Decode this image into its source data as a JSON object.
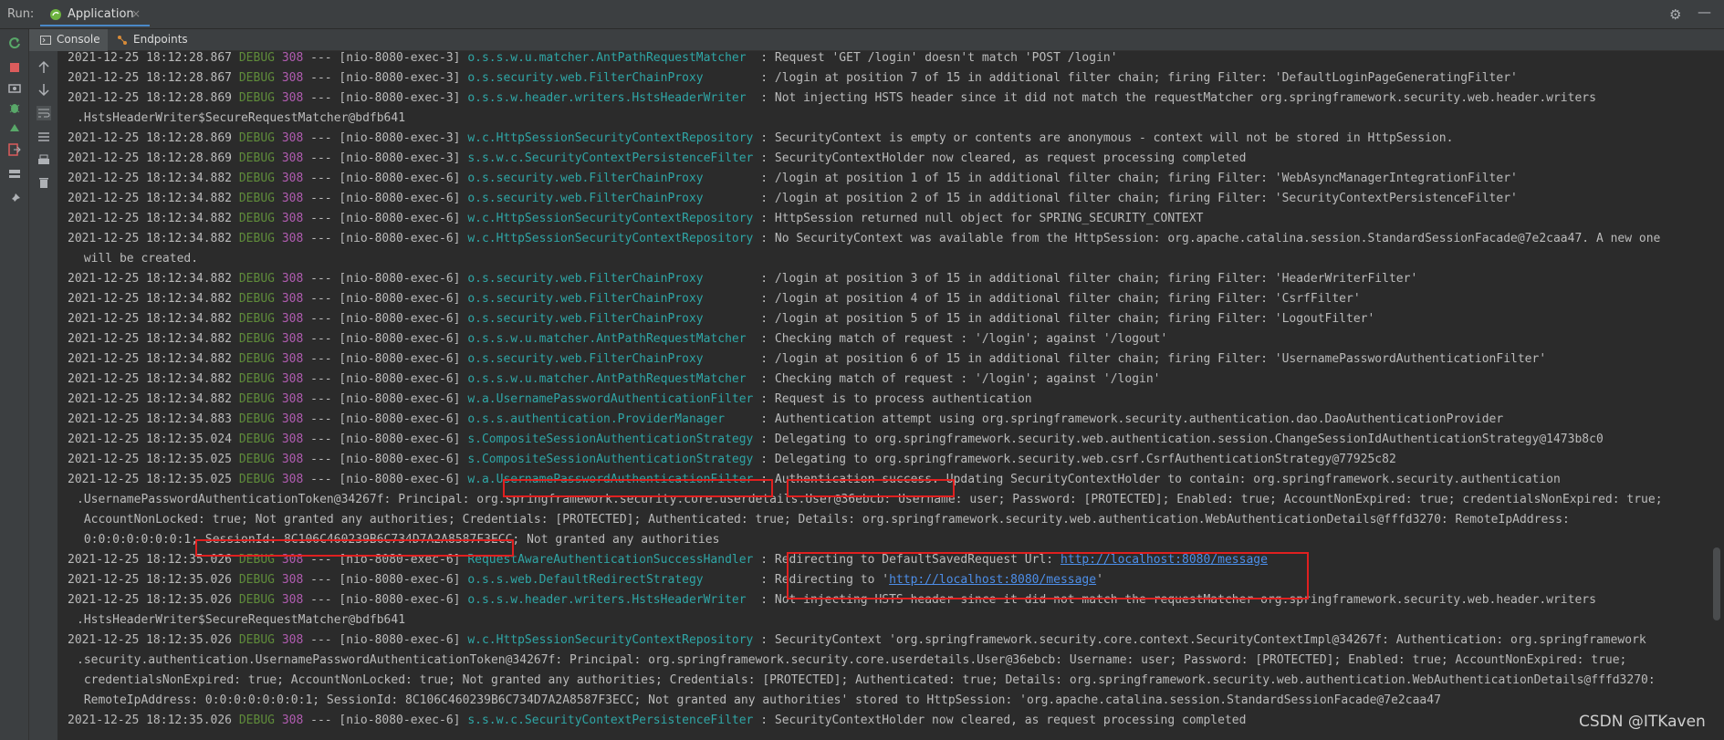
{
  "runbar": {
    "run_label": "Run:",
    "tab_title": "Application",
    "tab_close": "×"
  },
  "subtabs": {
    "console": "Console",
    "endpoints": "Endpoints"
  },
  "colors": {
    "debug": "#5f8c3a",
    "pid": "#b05cb0",
    "logger": "#2fa6a6",
    "highlight": "#e02020"
  },
  "log": [
    {
      "ts": "2021-12-25 18:12:28.867",
      "lvl": "DEBUG",
      "pid": "308",
      "thread": " --- [nio-8080-exec-3] ",
      "logger": "o.s.s.w.u.matcher.AntPathRequestMatcher  ",
      "msg": ": Request 'GET /login' doesn't match 'POST /login'"
    },
    {
      "ts": "2021-12-25 18:12:28.867",
      "lvl": "DEBUG",
      "pid": "308",
      "thread": " --- [nio-8080-exec-3] ",
      "logger": "o.s.security.web.FilterChainProxy        ",
      "msg": ": /login at position 7 of 15 in additional filter chain; firing Filter: 'DefaultLoginPageGeneratingFilter'"
    },
    {
      "ts": "2021-12-25 18:12:28.869",
      "lvl": "DEBUG",
      "pid": "308",
      "thread": " --- [nio-8080-exec-3] ",
      "logger": "o.s.s.w.header.writers.HstsHeaderWriter  ",
      "msg": ": Not injecting HSTS header since it did not match the requestMatcher org.springframework.security.web.header.writers"
    },
    {
      "cont": ".HstsHeaderWriter$SecureRequestMatcher@bdfb641"
    },
    {
      "ts": "2021-12-25 18:12:28.869",
      "lvl": "DEBUG",
      "pid": "308",
      "thread": " --- [nio-8080-exec-3] ",
      "logger": "w.c.HttpSessionSecurityContextRepository ",
      "msg": ": SecurityContext is empty or contents are anonymous - context will not be stored in HttpSession."
    },
    {
      "ts": "2021-12-25 18:12:28.869",
      "lvl": "DEBUG",
      "pid": "308",
      "thread": " --- [nio-8080-exec-3] ",
      "logger": "s.s.w.c.SecurityContextPersistenceFilter ",
      "msg": ": SecurityContextHolder now cleared, as request processing completed"
    },
    {
      "ts": "2021-12-25 18:12:34.882",
      "lvl": "DEBUG",
      "pid": "308",
      "thread": " --- [nio-8080-exec-6] ",
      "logger": "o.s.security.web.FilterChainProxy        ",
      "msg": ": /login at position 1 of 15 in additional filter chain; firing Filter: 'WebAsyncManagerIntegrationFilter'"
    },
    {
      "ts": "2021-12-25 18:12:34.882",
      "lvl": "DEBUG",
      "pid": "308",
      "thread": " --- [nio-8080-exec-6] ",
      "logger": "o.s.security.web.FilterChainProxy        ",
      "msg": ": /login at position 2 of 15 in additional filter chain; firing Filter: 'SecurityContextPersistenceFilter'"
    },
    {
      "ts": "2021-12-25 18:12:34.882",
      "lvl": "DEBUG",
      "pid": "308",
      "thread": " --- [nio-8080-exec-6] ",
      "logger": "w.c.HttpSessionSecurityContextRepository ",
      "msg": ": HttpSession returned null object for SPRING_SECURITY_CONTEXT"
    },
    {
      "ts": "2021-12-25 18:12:34.882",
      "lvl": "DEBUG",
      "pid": "308",
      "thread": " --- [nio-8080-exec-6] ",
      "logger": "w.c.HttpSessionSecurityContextRepository ",
      "msg": ": No SecurityContext was available from the HttpSession: org.apache.catalina.session.StandardSessionFacade@7e2caa47. A new one"
    },
    {
      "cont": " will be created."
    },
    {
      "ts": "2021-12-25 18:12:34.882",
      "lvl": "DEBUG",
      "pid": "308",
      "thread": " --- [nio-8080-exec-6] ",
      "logger": "o.s.security.web.FilterChainProxy        ",
      "msg": ": /login at position 3 of 15 in additional filter chain; firing Filter: 'HeaderWriterFilter'"
    },
    {
      "ts": "2021-12-25 18:12:34.882",
      "lvl": "DEBUG",
      "pid": "308",
      "thread": " --- [nio-8080-exec-6] ",
      "logger": "o.s.security.web.FilterChainProxy        ",
      "msg": ": /login at position 4 of 15 in additional filter chain; firing Filter: 'CsrfFilter'"
    },
    {
      "ts": "2021-12-25 18:12:34.882",
      "lvl": "DEBUG",
      "pid": "308",
      "thread": " --- [nio-8080-exec-6] ",
      "logger": "o.s.security.web.FilterChainProxy        ",
      "msg": ": /login at position 5 of 15 in additional filter chain; firing Filter: 'LogoutFilter'"
    },
    {
      "ts": "2021-12-25 18:12:34.882",
      "lvl": "DEBUG",
      "pid": "308",
      "thread": " --- [nio-8080-exec-6] ",
      "logger": "o.s.s.w.u.matcher.AntPathRequestMatcher  ",
      "msg": ": Checking match of request : '/login'; against '/logout'"
    },
    {
      "ts": "2021-12-25 18:12:34.882",
      "lvl": "DEBUG",
      "pid": "308",
      "thread": " --- [nio-8080-exec-6] ",
      "logger": "o.s.security.web.FilterChainProxy        ",
      "msg": ": /login at position 6 of 15 in additional filter chain; firing Filter: 'UsernamePasswordAuthenticationFilter'"
    },
    {
      "ts": "2021-12-25 18:12:34.882",
      "lvl": "DEBUG",
      "pid": "308",
      "thread": " --- [nio-8080-exec-6] ",
      "logger": "o.s.s.w.u.matcher.AntPathRequestMatcher  ",
      "msg": ": Checking match of request : '/login'; against '/login'"
    },
    {
      "ts": "2021-12-25 18:12:34.882",
      "lvl": "DEBUG",
      "pid": "308",
      "thread": " --- [nio-8080-exec-6] ",
      "logger": "w.a.UsernamePasswordAuthenticationFilter ",
      "msg": ": Request is to process authentication"
    },
    {
      "ts": "2021-12-25 18:12:34.883",
      "lvl": "DEBUG",
      "pid": "308",
      "thread": " --- [nio-8080-exec-6] ",
      "logger": "o.s.s.authentication.ProviderManager     ",
      "msg": ": Authentication attempt using org.springframework.security.authentication.dao.DaoAuthenticationProvider"
    },
    {
      "ts": "2021-12-25 18:12:35.024",
      "lvl": "DEBUG",
      "pid": "308",
      "thread": " --- [nio-8080-exec-6] ",
      "logger": "s.CompositeSessionAuthenticationStrategy ",
      "msg": ": Delegating to org.springframework.security.web.authentication.session.ChangeSessionIdAuthenticationStrategy@1473b8c0"
    },
    {
      "ts": "2021-12-25 18:12:35.025",
      "lvl": "DEBUG",
      "pid": "308",
      "thread": " --- [nio-8080-exec-6] ",
      "logger": "s.CompositeSessionAuthenticationStrategy ",
      "msg": ": Delegating to org.springframework.security.web.csrf.CsrfAuthenticationStrategy@77925c82"
    },
    {
      "ts": "2021-12-25 18:12:35.025",
      "lvl": "DEBUG",
      "pid": "308",
      "thread": " --- [nio-8080-exec-6] ",
      "logger": "w.a.UsernamePasswordAuthenticationFilter ",
      "msg": ": Authentication success. Updating SecurityContextHolder to contain: org.springframework.security.authentication"
    },
    {
      "cont": ".UsernamePasswordAuthenticationToken@34267f: Principal: org.springframework.security.core.userdetails.User@36ebcb: Username: user; Password: [PROTECTED]; Enabled: true; AccountNonExpired: true; credentialsNonExpired: true;"
    },
    {
      "cont": " AccountNonLocked: true; Not granted any authorities; Credentials: [PROTECTED]; Authenticated: true; Details: org.springframework.security.web.authentication.WebAuthenticationDetails@fffd3270: RemoteIpAddress:"
    },
    {
      "cont": " 0:0:0:0:0:0:0:1; SessionId: 8C106C460239B6C734D7A2A8587F3ECC; Not granted any authorities"
    },
    {
      "ts": "2021-12-25 18:12:35.026",
      "lvl": "DEBUG",
      "pid": "308",
      "thread": " --- [nio-8080-exec-6] ",
      "logger": "RequestAwareAuthenticationSuccessHandler ",
      "msg": ": Redirecting to DefaultSavedRequest Url: ",
      "link": "http://localhost:8080/message",
      "tail": ""
    },
    {
      "ts": "2021-12-25 18:12:35.026",
      "lvl": "DEBUG",
      "pid": "308",
      "thread": " --- [nio-8080-exec-6] ",
      "logger": "o.s.s.web.DefaultRedirectStrategy        ",
      "msg": ": Redirecting to '",
      "link": "http://localhost:8080/message",
      "tail": "'"
    },
    {
      "ts": "2021-12-25 18:12:35.026",
      "lvl": "DEBUG",
      "pid": "308",
      "thread": " --- [nio-8080-exec-6] ",
      "logger": "o.s.s.w.header.writers.HstsHeaderWriter  ",
      "msg": ": Not injecting HSTS header since it did not match the requestMatcher org.springframework.security.web.header.writers"
    },
    {
      "cont": ".HstsHeaderWriter$SecureRequestMatcher@bdfb641"
    },
    {
      "ts": "2021-12-25 18:12:35.026",
      "lvl": "DEBUG",
      "pid": "308",
      "thread": " --- [nio-8080-exec-6] ",
      "logger": "w.c.HttpSessionSecurityContextRepository ",
      "msg": ": SecurityContext 'org.springframework.security.core.context.SecurityContextImpl@34267f: Authentication: org.springframework"
    },
    {
      "cont": ".security.authentication.UsernamePasswordAuthenticationToken@34267f: Principal: org.springframework.security.core.userdetails.User@36ebcb: Username: user; Password: [PROTECTED]; Enabled: true; AccountNonExpired: true;"
    },
    {
      "cont": " credentialsNonExpired: true; AccountNonLocked: true; Not granted any authorities; Credentials: [PROTECTED]; Authenticated: true; Details: org.springframework.security.web.authentication.WebAuthenticationDetails@fffd3270:"
    },
    {
      "cont": " RemoteIpAddress: 0:0:0:0:0:0:0:1; SessionId: 8C106C460239B6C734D7A2A8587F3ECC; Not granted any authorities' stored to HttpSession: 'org.apache.catalina.session.StandardSessionFacade@7e2caa47"
    },
    {
      "ts": "2021-12-25 18:12:35.026",
      "lvl": "DEBUG",
      "pid": "308",
      "thread": " --- [nio-8080-exec-6] ",
      "logger": "s.s.w.c.SecurityContextPersistenceFilter ",
      "msg": ": SecurityContextHolder now cleared, as request processing completed"
    }
  ],
  "watermark": "CSDN @ITKaven"
}
